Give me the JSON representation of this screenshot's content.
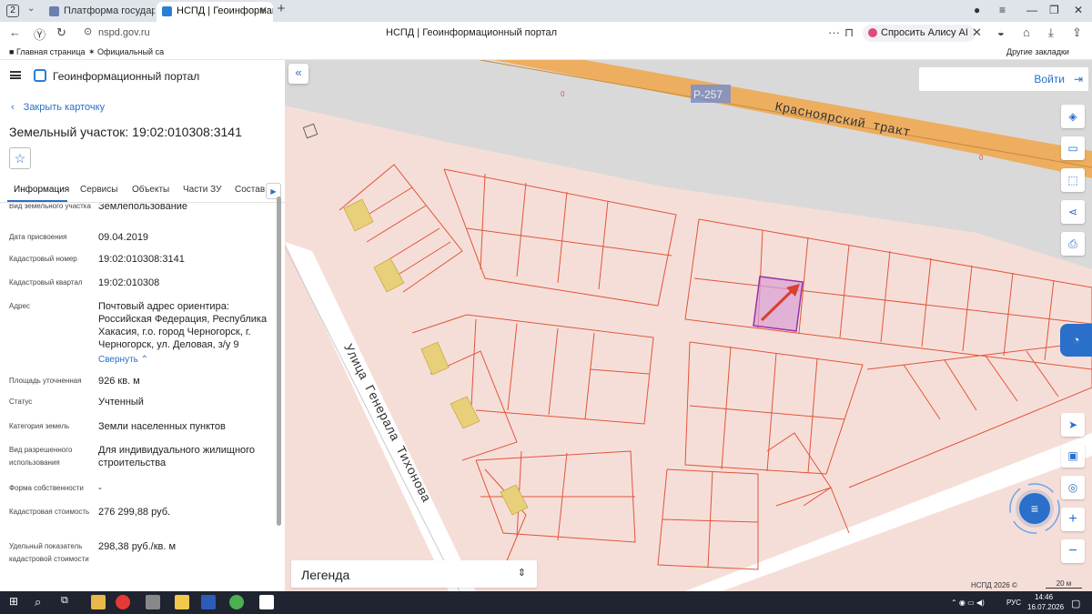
{
  "browser": {
    "tab_count": "2",
    "tabs": [
      {
        "label": "Платформа государствен",
        "active": false
      },
      {
        "label": "НСПД | Геоинформацио",
        "active": true
      }
    ],
    "url": "nspd.gov.ru",
    "page_title": "НСПД | Геоинформационный портал",
    "alice_label": "Спросить Алису AI",
    "bookmarks": [
      "Главная страница",
      "Официальный са"
    ],
    "other_bookmarks": "Другие закладки"
  },
  "panel": {
    "portal_title": "Геоинформационный портал",
    "close_card": "Закрыть карточку",
    "parcel_title": "Земельный участок: 19:02:010308:3141",
    "tabs": [
      "Информация",
      "Сервисы",
      "Объекты",
      "Части ЗУ",
      "Состав"
    ],
    "props": [
      {
        "k": "Вид земельного участка",
        "v": "Землепользование"
      },
      {
        "k": "Дата присвоения",
        "v": "09.04.2019"
      },
      {
        "k": "Кадастровый номер",
        "v": "19:02:010308:3141"
      },
      {
        "k": "Кадастровый квартал",
        "v": "19:02:010308"
      },
      {
        "k": "Адрес",
        "v": "Почтовый адрес ориентира: Российская Федерация, Республика Хакасия, г.о. город Черногорск, г. Черногорск, ул. Деловая, з/у 9"
      },
      {
        "k": "Площадь уточненная",
        "v": "926 кв. м"
      },
      {
        "k": "Статус",
        "v": "Учтенный"
      },
      {
        "k": "Категория земель",
        "v": "Земли населенных пунктов"
      },
      {
        "k": "Вид разрешенного использования",
        "v": "Для индивидуального жилищного строительства"
      },
      {
        "k": "Форма собственности",
        "v": "-"
      },
      {
        "k": "Кадастровая стоимость",
        "v": "276 299,88 руб."
      },
      {
        "k": "Удельный показатель кадастровой стоимости",
        "v": "298,38 руб./кв. м"
      }
    ],
    "collapse": "Свернуть"
  },
  "map": {
    "login": "Войти",
    "road_badge": "Р-257",
    "road_name": "Красноярский тракт",
    "street_name": "Улица Генерала Тихонова",
    "parcel_marker": "0",
    "legend": "Легенда",
    "credit": "НСПД 2026 ©",
    "scale": "20 м"
  },
  "taskbar": {
    "lang": "РУС",
    "time": "14:46",
    "date": "16.07.2026"
  },
  "colors": {
    "accent": "#2a6fc9",
    "parcel_line": "#e0553a",
    "highway": "#f0a64a",
    "selected": "#9b2fa8",
    "building": "#e8d07a"
  }
}
